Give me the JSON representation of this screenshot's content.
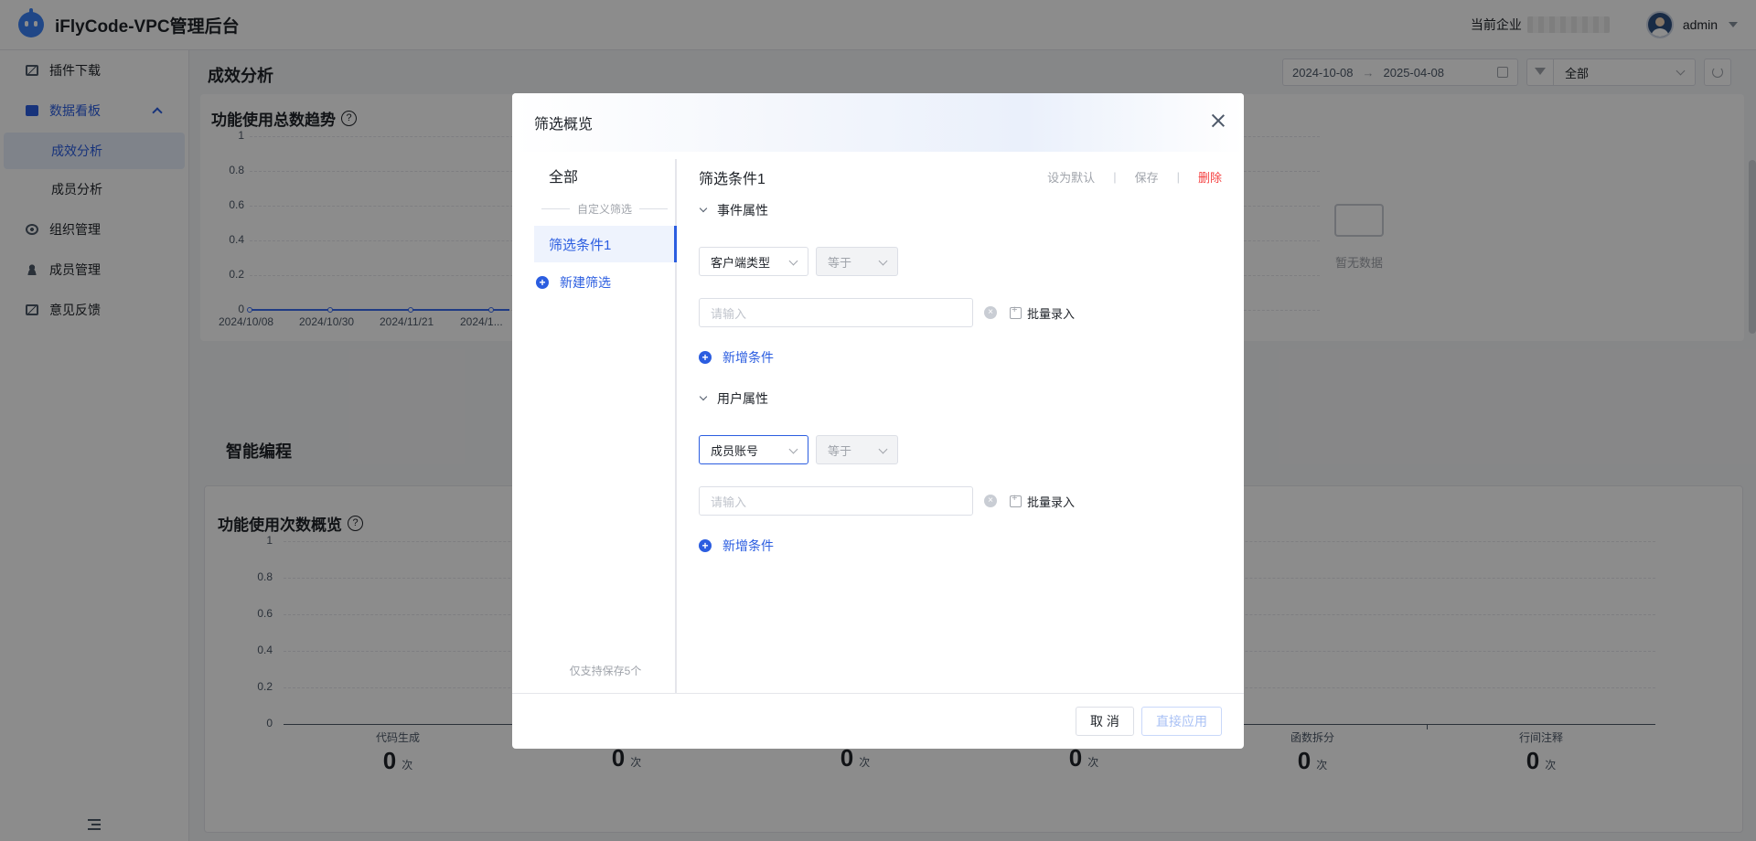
{
  "header": {
    "app_title": "iFlyCode-VPC管理后台",
    "enterprise_label": "当前企业",
    "user_name": "admin"
  },
  "sidebar": {
    "items": [
      {
        "label": "插件下载",
        "icon": "chart-icon"
      },
      {
        "label": "数据看板",
        "icon": "bar-chart-icon",
        "expanded": true
      },
      {
        "label": "成效分析",
        "sub": true,
        "active": true
      },
      {
        "label": "成员分析",
        "sub": true
      },
      {
        "label": "组织管理",
        "icon": "org-icon"
      },
      {
        "label": "成员管理",
        "icon": "user-icon"
      },
      {
        "label": "意见反馈",
        "icon": "chart-icon"
      }
    ]
  },
  "main": {
    "page_title": "成效分析",
    "date_start": "2024-10-08",
    "date_end": "2025-04-08",
    "filter_value": "全部",
    "trend_title": "功能使用总数趋势",
    "trend_empty": "暂无数据",
    "section_title": "智能编程",
    "overview_title": "功能使用次数概览"
  },
  "chart_data": [
    {
      "type": "line",
      "title": "功能使用总数趋势",
      "x": [
        "2024/10/08",
        "2024/10/30",
        "2024/11/21",
        "2024/1..."
      ],
      "series": [
        {
          "values": [
            0,
            0,
            0,
            0
          ]
        }
      ],
      "yticks": [
        "1",
        "0.8",
        "0.6",
        "0.4",
        "0.2",
        "0"
      ],
      "ylim": [
        0,
        1
      ],
      "grid": true
    },
    {
      "type": "bar",
      "title": "功能使用次数概览",
      "categories": [
        "代码生成",
        "",
        "",
        "",
        "函数拆分",
        "行间注释"
      ],
      "values": [
        0,
        0,
        0,
        0,
        0,
        0
      ],
      "unit": "次",
      "yticks": [
        "1",
        "0.8",
        "0.6",
        "0.4",
        "0.2",
        "0"
      ],
      "ylim": [
        0,
        1
      ],
      "grid": true
    }
  ],
  "modal": {
    "title": "筛选概览",
    "left": {
      "all_label": "全部",
      "divider_label": "自定义筛选",
      "item_label": "筛选条件1",
      "new_label": "新建筛选",
      "footer_note": "仅支持保存5个"
    },
    "right": {
      "title": "筛选条件1",
      "set_default": "设为默认",
      "save": "保存",
      "delete": "删除",
      "groups": [
        {
          "title": "事件属性",
          "field": "客户端类型",
          "operator": "等于",
          "placeholder": "请输入",
          "batch_label": "批量录入",
          "add_label": "新增条件"
        },
        {
          "title": "用户属性",
          "field": "成员账号",
          "operator": "等于",
          "placeholder": "请输入",
          "batch_label": "批量录入",
          "add_label": "新增条件"
        }
      ]
    },
    "footer": {
      "cancel": "取 消",
      "apply": "直接应用"
    }
  }
}
